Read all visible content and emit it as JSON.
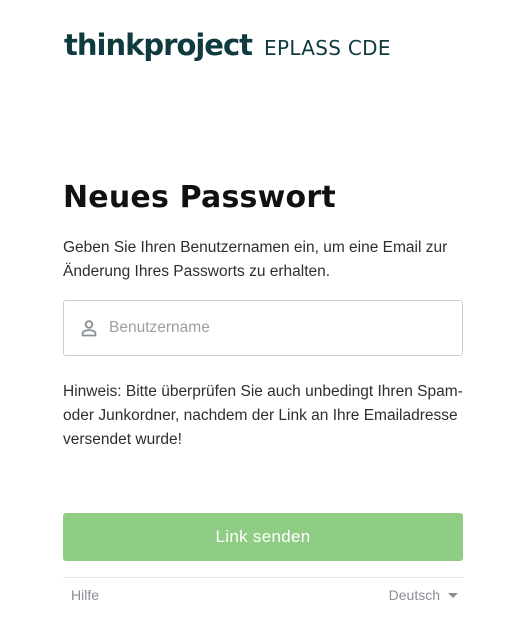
{
  "brand": {
    "name": "thinkproject",
    "product": "EPLASS CDE",
    "color": "#0f3a3f"
  },
  "page": {
    "title": "Neues Passwort",
    "description": "Geben Sie Ihren Benutzernamen ein, um eine Email zur Änderung Ihres Passworts zu erhalten.",
    "note": "Hinweis: Bitte überprüfen Sie auch unbedingt Ihren Spam- oder Junkordner, nachdem der Link an Ihre Emailadresse versendet wurde!"
  },
  "form": {
    "username": {
      "icon": "user-icon",
      "value": "",
      "placeholder": "Benutzername"
    },
    "submit_label": "Link senden",
    "submit_color": "#8fcd85"
  },
  "footer": {
    "help_label": "Hilfe",
    "language_label": "Deutsch",
    "language_icon": "caret-down-icon"
  }
}
